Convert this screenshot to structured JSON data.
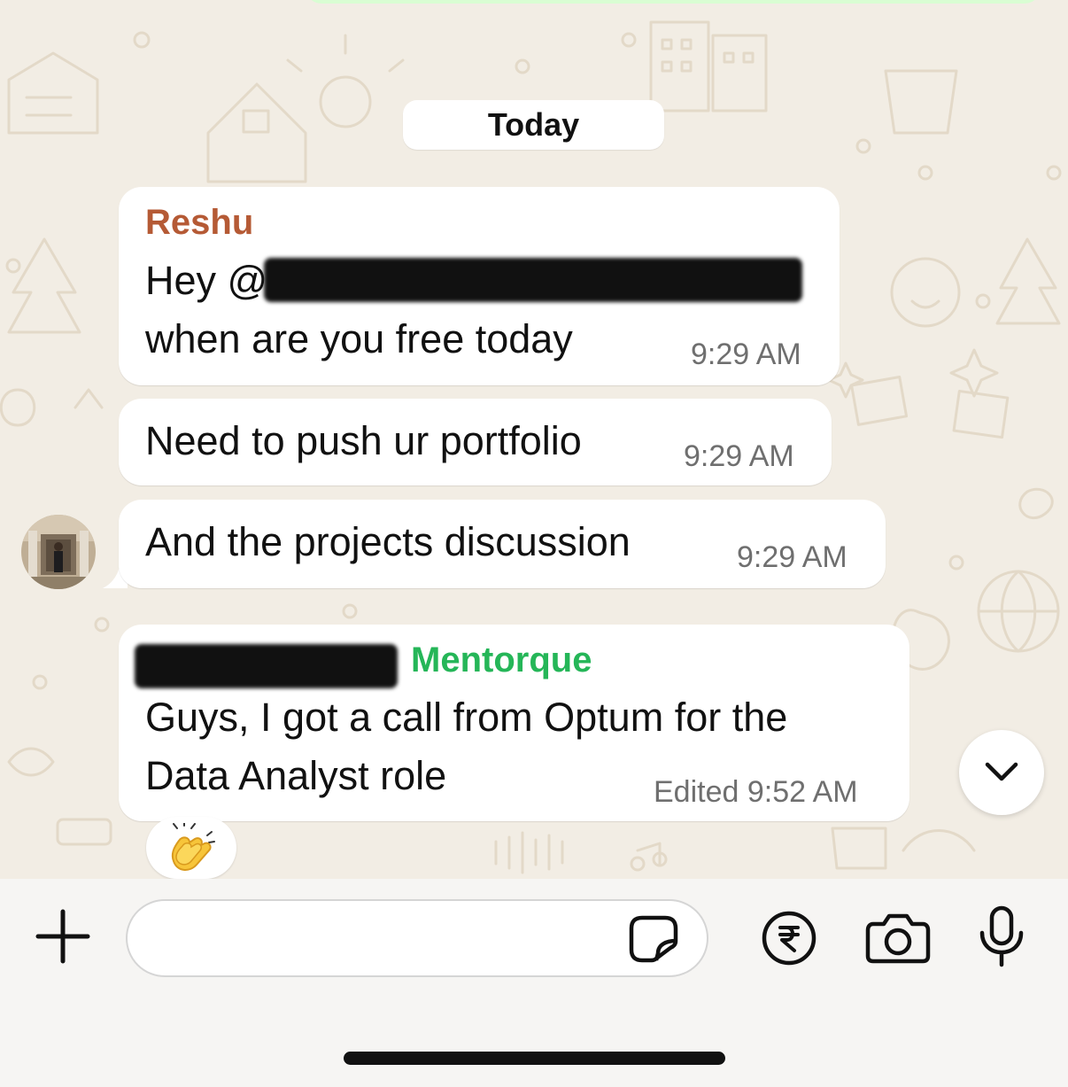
{
  "date_separator": "Today",
  "messages": [
    {
      "sender": "Reshu",
      "sender_color": "#b55a35",
      "line1_prefix": "Hey @",
      "line2": "when are you free today",
      "time": "9:29 AM"
    },
    {
      "text": "Need to push ur portfolio",
      "time": "9:29 AM"
    },
    {
      "text": "And the projects discussion",
      "time": "9:29 AM"
    },
    {
      "sender_suffix": "Mentorque",
      "sender_color": "#25b658",
      "line1": "Guys, I got a call from Optum for the",
      "line2": "Data Analyst role",
      "edited_label": "Edited",
      "time": "9:52 AM",
      "reaction": "👏"
    }
  ],
  "colors": {
    "chat_background": "#f2ede4",
    "bubble": "#ffffff",
    "outgoing_bubble": "#d9fdd3",
    "timestamp": "#6f6f6f"
  },
  "input": {
    "placeholder": ""
  },
  "icons": {
    "add": "plus-icon",
    "sticker": "sticker-icon",
    "payment": "rupee-icon",
    "camera": "camera-icon",
    "microphone": "microphone-icon",
    "scroll_down": "chevron-down-icon"
  }
}
